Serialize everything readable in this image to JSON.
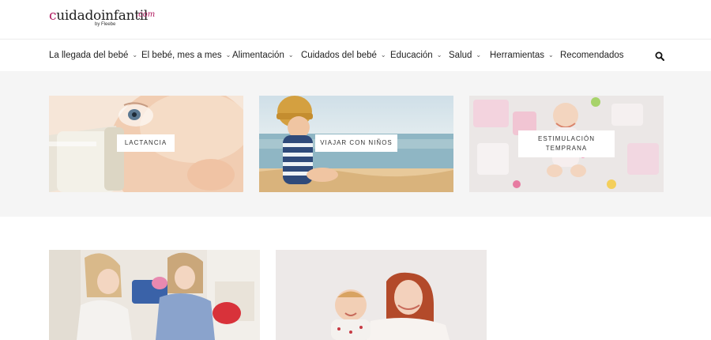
{
  "logo": {
    "name_part1": "c",
    "name_part2": "uidadoinfantil",
    "tld": ".com",
    "byline": "by Fleebe"
  },
  "nav": {
    "items": [
      {
        "label": "La llegada del bebé",
        "has_dropdown": true
      },
      {
        "label": "El bebé, mes a mes",
        "has_dropdown": true
      },
      {
        "label": "Alimentación",
        "has_dropdown": true
      },
      {
        "label": "Cuidados del bebé",
        "has_dropdown": true
      },
      {
        "label": "Educación",
        "has_dropdown": true
      },
      {
        "label": "Salud",
        "has_dropdown": true
      },
      {
        "label": "Herramientas",
        "has_dropdown": true
      },
      {
        "label": "Recomendados",
        "has_dropdown": false
      }
    ],
    "search_icon": "search-icon"
  },
  "categories": [
    {
      "label": "LACTANCIA"
    },
    {
      "label": "VIAJAR CON NIÑOS"
    },
    {
      "label_line1": "ESTIMULACIÓN",
      "label_line2": "TEMPRANA"
    }
  ],
  "colors": {
    "brand_accent": "#b0185e",
    "band_background": "#f5f5f5"
  }
}
